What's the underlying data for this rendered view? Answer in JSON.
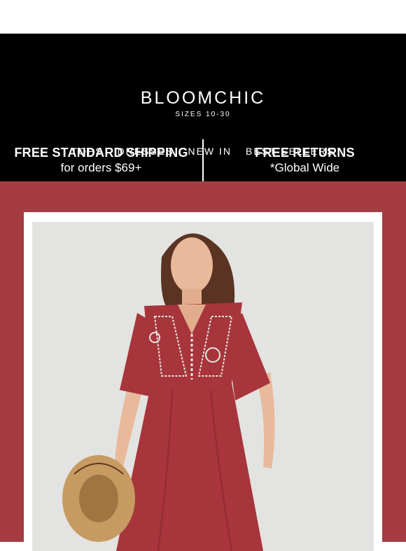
{
  "brand": {
    "logo": "BLOOMCHIC",
    "tagline": "SIZES 10-30"
  },
  "nav": {
    "items": [
      {
        "label": "TOPS"
      },
      {
        "label": "DRESSES"
      },
      {
        "label": "NEW IN"
      },
      {
        "label": "BEST SELLERS"
      }
    ]
  },
  "promo": {
    "shipping_title": "FREE STANDARD SHIPPING",
    "shipping_sub": "for orders $69+",
    "returns_title": "FREE RETURNS",
    "returns_sub": "*Global Wide"
  },
  "hero": {
    "product_image": "model-in-red-embroidered-dress",
    "colors": {
      "background": "#a53c41",
      "dress": "#a7353b"
    }
  }
}
